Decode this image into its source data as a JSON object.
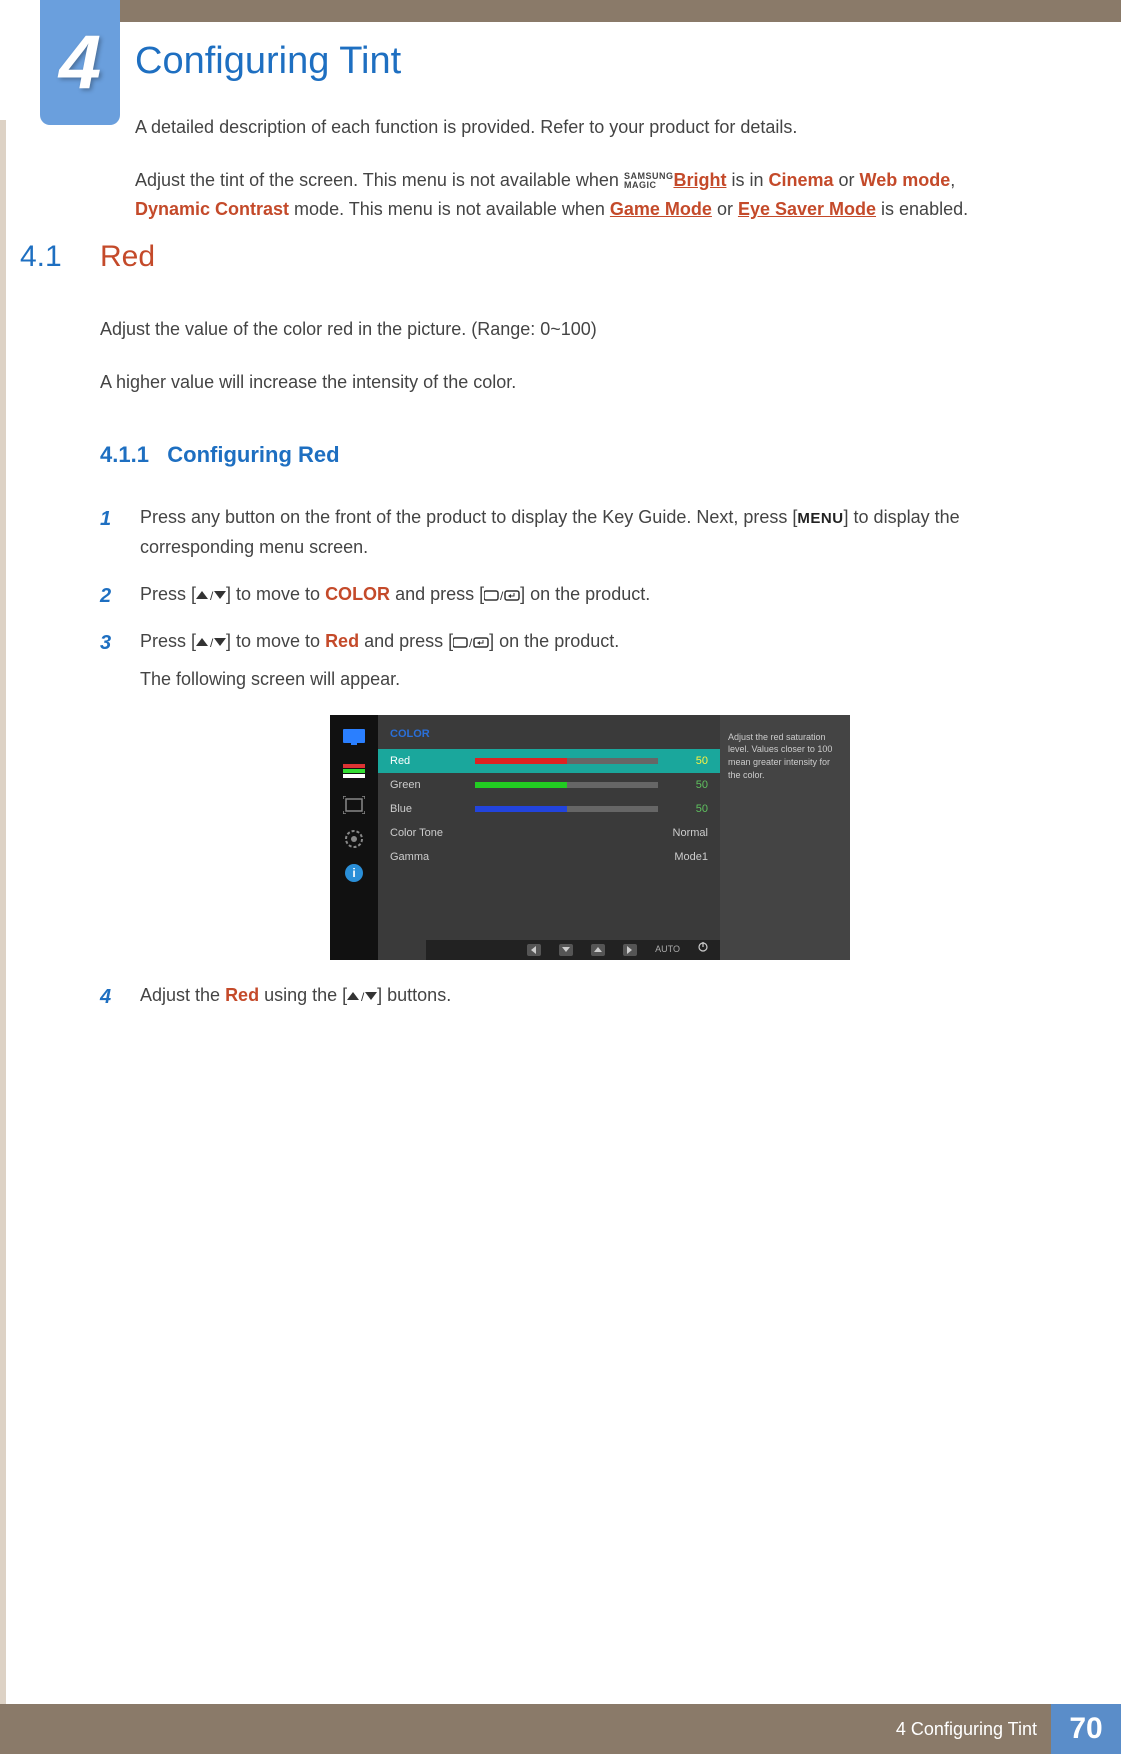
{
  "chapter": {
    "number": "4",
    "title": "Configuring Tint"
  },
  "intro": {
    "line1": "A detailed description of each function is provided. Refer to your product for details.",
    "line2_pre": "Adjust the tint of the screen. This menu is not available when ",
    "magic_top": "SAMSUNG",
    "magic_bottom": "MAGIC",
    "bright": "Bright",
    "line2_mid1": " is in ",
    "cinema": "Cinema",
    "line2_mid2": " or ",
    "webmode": "Web mode",
    "sep1": ", ",
    "dynamic": "Dynamic Contrast",
    "line2_mid3": " mode. This menu is not available when ",
    "gamemode": "Game Mode",
    "line2_mid4": " or ",
    "eyesaver": "Eye Saver Mode",
    "line2_end": " is enabled."
  },
  "section": {
    "num": "4.1",
    "title": "Red",
    "para1": "Adjust the value of the color red in the picture. (Range: 0~100)",
    "para2": "A higher value will increase the intensity of the color."
  },
  "subsection": {
    "num": "4.1.1",
    "title": "Configuring Red"
  },
  "steps": {
    "s1_num": "1",
    "s1_a": "Press any button on the front of the product to display the Key Guide. Next, press [",
    "s1_menu": "MENU",
    "s1_b": "] to display the corresponding menu screen.",
    "s2_num": "2",
    "s2_a": "Press [",
    "s2_b": "] to move to ",
    "s2_color": "COLOR",
    "s2_c": " and press [",
    "s2_d": "] on the product.",
    "s3_num": "3",
    "s3_a": "Press [",
    "s3_b": "] to move to ",
    "s3_red": "Red",
    "s3_c": " and press [",
    "s3_d": "] on the product.",
    "s3_sub": "The following screen will appear.",
    "s4_num": "4",
    "s4_a": "Adjust the ",
    "s4_red": "Red",
    "s4_b": " using the [",
    "s4_c": "] buttons."
  },
  "osd": {
    "title": "COLOR",
    "rows": {
      "red": {
        "label": "Red",
        "value": "50"
      },
      "green": {
        "label": "Green",
        "value": "50"
      },
      "blue": {
        "label": "Blue",
        "value": "50"
      },
      "tone": {
        "label": "Color Tone",
        "value": "Normal"
      },
      "gamma": {
        "label": "Gamma",
        "value": "Mode1"
      }
    },
    "help": "Adjust the red saturation level. Values closer to 100 mean greater intensity for the color.",
    "auto": "AUTO"
  },
  "footer": {
    "text": "4 Configuring Tint",
    "page": "70"
  }
}
